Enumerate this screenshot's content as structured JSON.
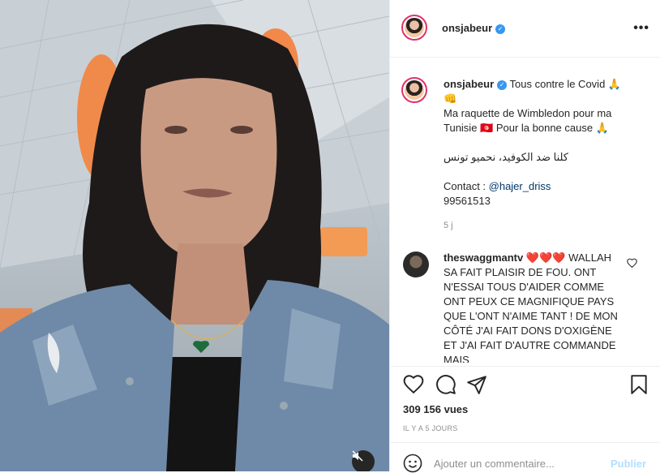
{
  "post": {
    "username": "onsjabeur",
    "more_icon": "•••",
    "caption_line1": "Tous contre le Covid 🙏",
    "caption_line2": "👊",
    "caption_line3": "Ma raquette de Wimbledon pour ma",
    "caption_line4": "Tunisie 🇹🇳 Pour la bonne cause 🙏",
    "caption_arabic": "كلنا ضد الكوفيد، نحميو تونس",
    "contact_label": "Contact : ",
    "contact_mention": "@hajer_driss",
    "contact_phone": "99561513",
    "age": "5 j"
  },
  "comment": {
    "username": "theswaggmantv",
    "hearts": "❤️❤️❤️",
    "text": "WALLAH SA FAIT PLAISIR DE FOU. ONT N'ESSAI TOUS D'AIDER COMME ONT PEUX CE MAGNIFIQUE PAYS QUE L'ONT N'AIME TANT ! DE MON CÔTÉ J'AI FAIT DONS D'OXIGÈNE ET J'AI FAIT D'AUTRE COMMANDE MAIS"
  },
  "stats": {
    "views": "309 156 vues",
    "date": "IL Y A 5 JOURS"
  },
  "composer": {
    "placeholder": "Ajouter un commentaire...",
    "publish": "Publier"
  },
  "icons": {
    "like": "heart-icon",
    "comment": "comment-icon",
    "share": "share-icon",
    "save": "bookmark-icon",
    "emoji": "emoji-icon",
    "mute": "speaker-muted-icon",
    "verified": "verified-badge-icon"
  },
  "colors": {
    "accent": "#3897f0",
    "publish_disabled": "#b2dffc",
    "mention": "#00376b",
    "muted_text": "#8e8e8e"
  }
}
